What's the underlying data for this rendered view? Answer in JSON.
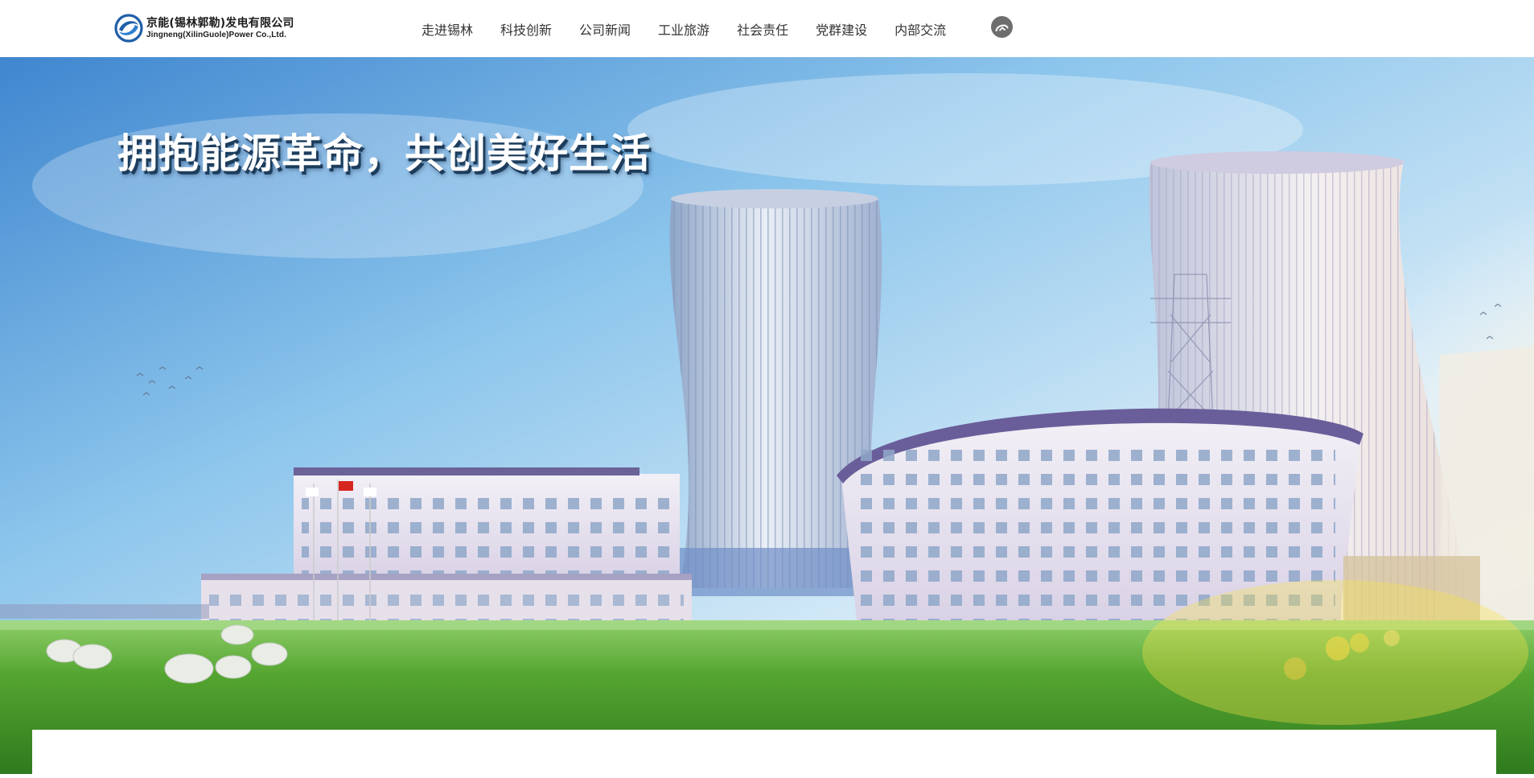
{
  "header": {
    "logo": {
      "name_cn": "京能(锡林郭勒)发电有限公司",
      "name_en": "Jingneng(XilinGuole)Power Co.,Ltd.",
      "icon": "company-logo-icon"
    },
    "nav": [
      {
        "label": "走进锡林"
      },
      {
        "label": "科技创新"
      },
      {
        "label": "公司新闻"
      },
      {
        "label": "工业旅游"
      },
      {
        "label": "社会责任"
      },
      {
        "label": "党群建设"
      },
      {
        "label": "内部交流"
      }
    ],
    "user_icon": "user-login-icon"
  },
  "banner": {
    "slogan": "拥抱能源革命，共创美好生活",
    "image": "power-plant-cooling-towers-banner"
  },
  "colors": {
    "header_bg": "#ffffff",
    "nav_text": "#333333",
    "logo_blue": "#1f5fa8",
    "user_icon_bg": "#6e6e6e",
    "sky_top": "#4f93d6",
    "grass": "#4c9a2e"
  }
}
